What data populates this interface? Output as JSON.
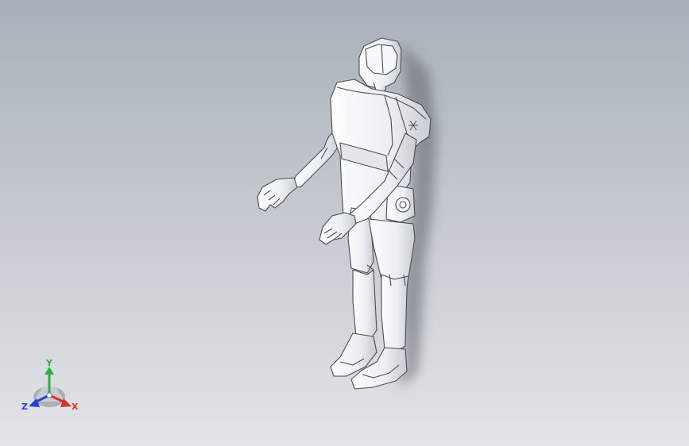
{
  "viewport": {
    "background_top": "#a9b0b9",
    "background_bottom": "#e2e4e7"
  },
  "model": {
    "part_fill": "#f1f2f4",
    "edge_color": "#4a4d52",
    "shadow_color": "#6f7680"
  },
  "triad": {
    "x_label": "X",
    "y_label": "Y",
    "z_label": "Z",
    "x_color": "#d8322a",
    "y_color": "#2fae3b",
    "z_color": "#2b3fd1"
  }
}
